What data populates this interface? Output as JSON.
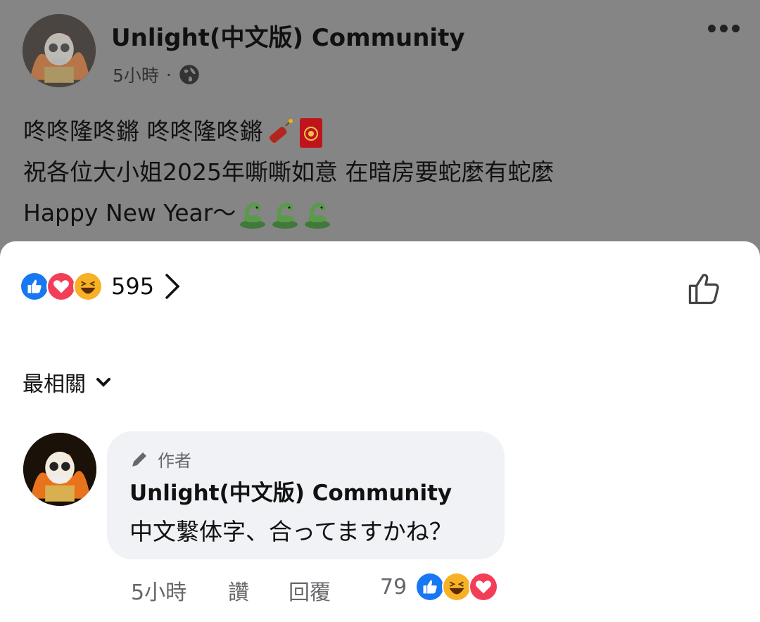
{
  "post": {
    "page_name": "Unlight(中文版) Community",
    "time": "5小時",
    "separator": "·",
    "audience_icon": "globe-icon",
    "more_icon": "more-dots-icon",
    "lines": [
      "咚咚隆咚鏘 咚咚隆咚鏘",
      "祝各位大小姐2025年嘶嘶如意 在暗房要蛇麼有蛇麼",
      "Happy New Year～"
    ],
    "line1_emojis": [
      "firecracker-emoji",
      "red-envelope-emoji"
    ],
    "line3_emojis": [
      "snake-emoji",
      "snake-emoji",
      "snake-emoji"
    ]
  },
  "reactions": {
    "icons": [
      "like-reaction-icon",
      "love-reaction-icon",
      "haha-reaction-icon"
    ],
    "count": "595",
    "chevron_icon": "chevron-right-icon",
    "like_button_icon": "thumbs-up-outline-icon"
  },
  "sort": {
    "label": "最相關",
    "icon": "chevron-down-icon"
  },
  "comment": {
    "badge": "作者",
    "badge_icon": "pen-icon",
    "author": "Unlight(中文版) Community",
    "text": "中文繫体字、合ってますかね？",
    "time": "5小時",
    "like_label": "讚",
    "reply_label": "回覆",
    "reaction_count": "79",
    "reaction_icons": [
      "like-reaction-icon",
      "haha-reaction-icon",
      "love-reaction-icon"
    ]
  },
  "colors": {
    "overlay": "#858585",
    "sheet": "#ffffff",
    "bubble": "#f0f2f5",
    "like_blue": "#1877f2",
    "love_red": "#f33e58",
    "haha_yellow": "#f7b125",
    "secondary_text": "#65676b"
  }
}
